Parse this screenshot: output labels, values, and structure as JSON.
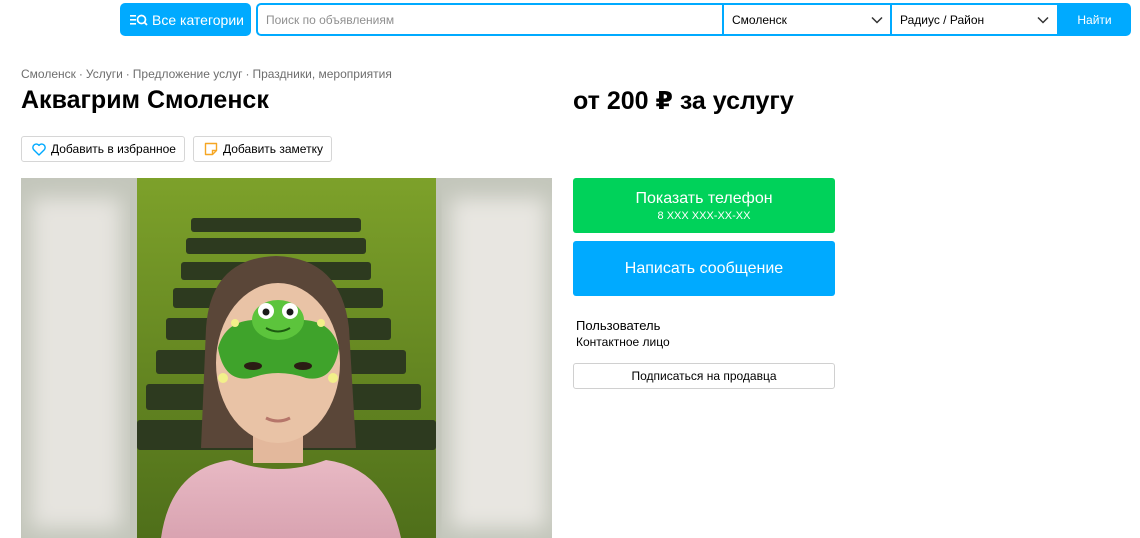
{
  "header": {
    "categories_label": "Все категории",
    "search_placeholder": "Поиск по объявлениям",
    "city": "Смоленск",
    "radius": "Радиус / Район",
    "find_label": "Найти"
  },
  "breadcrumbs": [
    "Смоленск",
    "Услуги",
    "Предложение услуг",
    "Праздники, мероприятия"
  ],
  "breadcrumb_separator": "·",
  "listing": {
    "title": "Аквагрим Смоленск",
    "price": "от 200 ₽ за услугу",
    "favorite_label": "Добавить в избранное",
    "note_label": "Добавить заметку"
  },
  "contact": {
    "show_phone_label": "Показать телефон",
    "phone_masked": "8 XXX XXX-XX-XX",
    "message_label": "Написать сообщение",
    "seller_name": "Пользователь",
    "seller_role": "Контактное лицо",
    "subscribe_label": "Подписаться на продавца"
  },
  "colors": {
    "accent": "#00aaff",
    "phone_button": "#00d25a"
  },
  "icons": {
    "categories": "search-list-icon",
    "dropdown": "chevron-down-icon",
    "favorite": "heart-icon",
    "note": "note-icon"
  }
}
